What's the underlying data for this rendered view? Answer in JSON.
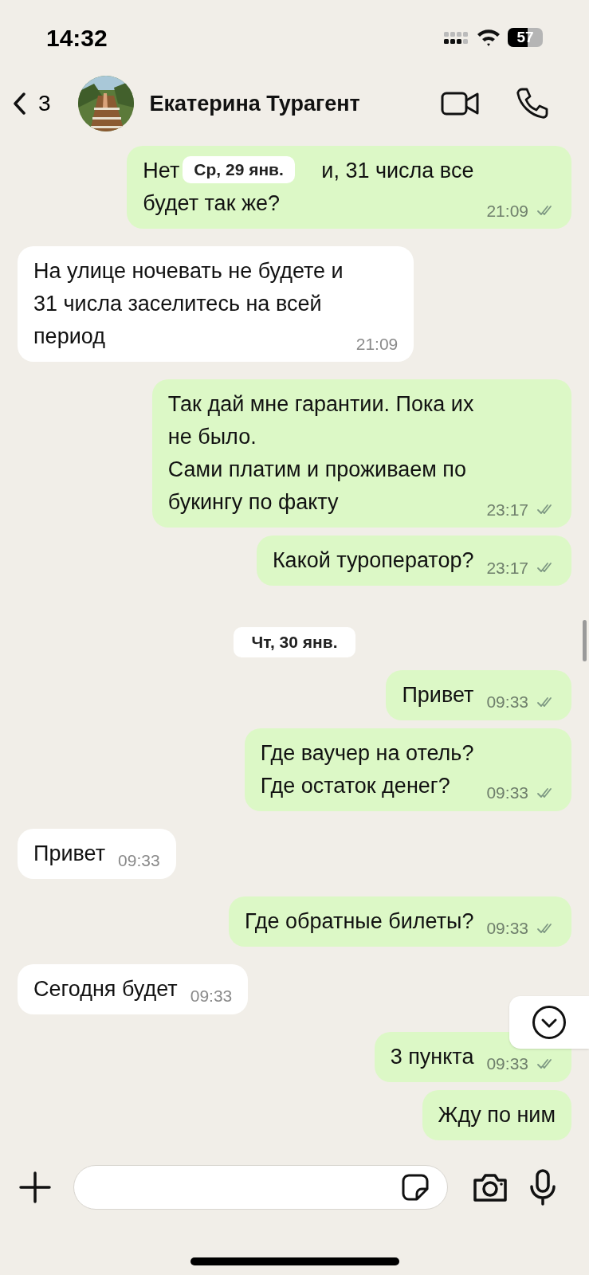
{
  "status_bar": {
    "time": "14:32",
    "battery": "57"
  },
  "header": {
    "back_count": "3",
    "contact_name": "Екатерина Турагент"
  },
  "sticky_date": "Ср, 29 янв.",
  "messages": [
    {
      "kind": "out",
      "text_before_date": "Нет",
      "text": "и, 31 числа все\nбудет так же?",
      "time": "21:09",
      "delivered": true
    },
    {
      "kind": "in",
      "text": "На улице ночевать не будете и\n31 числа заселитесь на всей\nпериод",
      "time": "21:09"
    },
    {
      "kind": "out",
      "text": "Так дай мне гарантии. Пока их\nне было.\nСами платим и проживаем по\nбукингу по факту",
      "time": "23:17",
      "delivered": true
    },
    {
      "kind": "out",
      "text": "Какой туроператор?",
      "time": "23:17",
      "delivered": true
    },
    {
      "kind": "date",
      "text": "Чт, 30 янв."
    },
    {
      "kind": "out",
      "text": "Привет",
      "time": "09:33",
      "delivered": true
    },
    {
      "kind": "out",
      "text": "Где ваучер на отель?\nГде остаток денег?",
      "time": "09:33",
      "delivered": true
    },
    {
      "kind": "in",
      "text": "Привет",
      "time": "09:33"
    },
    {
      "kind": "out",
      "text": "Где обратные билеты?",
      "time": "09:33",
      "delivered": true
    },
    {
      "kind": "in",
      "text": "Сегодня будет",
      "time": "09:33"
    },
    {
      "kind": "out",
      "text": "3 пункта",
      "time": "09:33",
      "delivered": true
    },
    {
      "kind": "out",
      "text": "Жду по ним"
    }
  ]
}
